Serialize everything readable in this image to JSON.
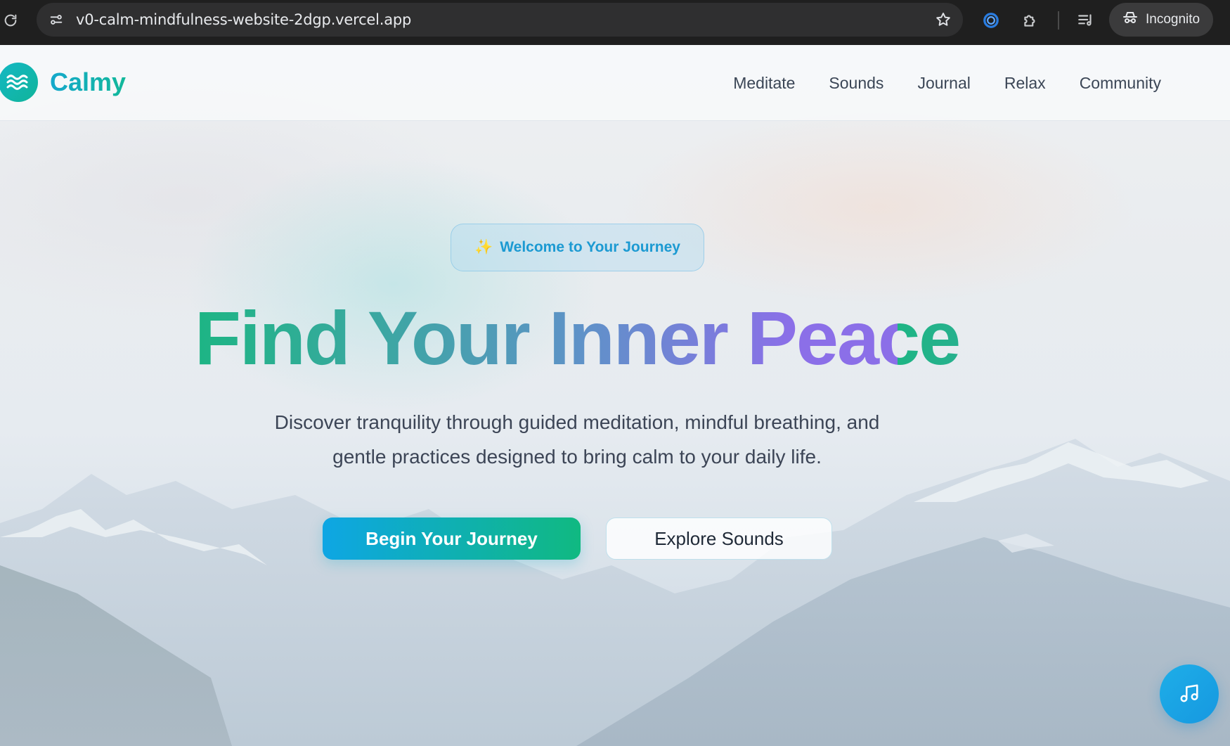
{
  "browser": {
    "url": "v0-calm-mindfulness-website-2dgp.vercel.app",
    "incognito_label": "Incognito"
  },
  "nav": {
    "brand": "Calmy",
    "links": [
      "Meditate",
      "Sounds",
      "Journal",
      "Relax",
      "Community"
    ]
  },
  "hero": {
    "badge_emoji": "✨",
    "badge_text": "Welcome to Your Journey",
    "headline": "Find Your Inner Peace",
    "subtitle_line1": "Discover tranquility through guided meditation, mindful breathing, and",
    "subtitle_line2": "gentle practices designed to bring calm to your daily life.",
    "primary_button": "Begin Your Journey",
    "secondary_button": "Explore Sounds"
  },
  "colors": {
    "brand_teal": "#14b8c4",
    "gradient_start": "#0ea6e4",
    "gradient_end": "#10b981",
    "headline_violet": "#8b6fe8",
    "fab_blue": "#1eaee8"
  },
  "icons": {
    "logo": "waves-icon",
    "fab": "music-note-icon"
  }
}
